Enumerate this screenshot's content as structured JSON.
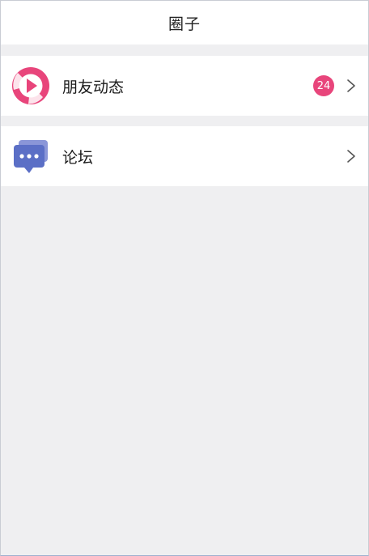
{
  "navbar": {
    "title": "圈子"
  },
  "rows": [
    {
      "label": "朋友动态",
      "icon": "moments-play-icon",
      "badge": "24",
      "icon_color": "#e8457b"
    },
    {
      "label": "论坛",
      "icon": "forum-chat-icon",
      "icon_color": "#5b6fc6"
    }
  ],
  "colors": {
    "badge": "#e8457b",
    "background": "#efeff1",
    "chevron": "#555555"
  }
}
